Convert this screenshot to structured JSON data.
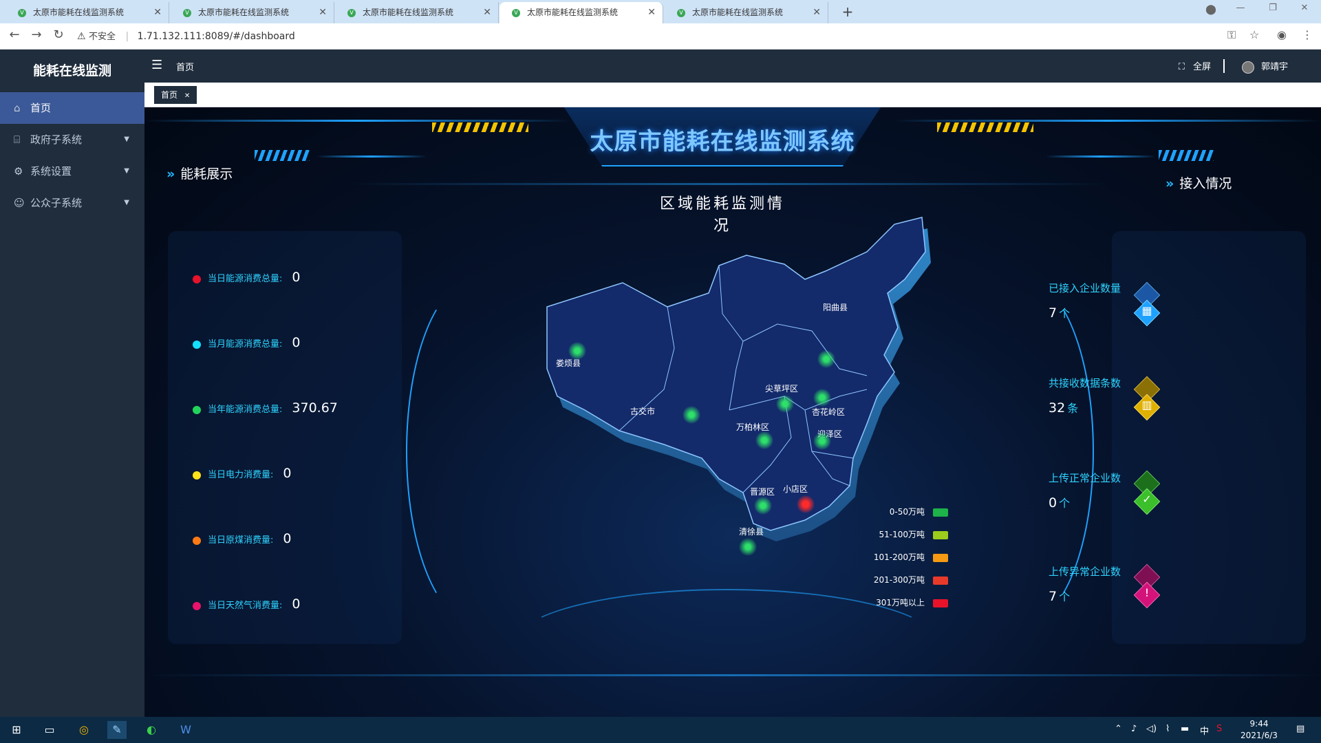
{
  "browser": {
    "tabs": [
      {
        "title": "太原市能耗在线监测系统"
      },
      {
        "title": "太原市能耗在线监测系统"
      },
      {
        "title": "太原市能耗在线监测系统"
      },
      {
        "title": "太原市能耗在线监测系统"
      },
      {
        "title": "太原市能耗在线监测系统"
      }
    ],
    "active_tab": 3,
    "security_label": "不安全",
    "url": "1.71.132.111:8089/#/dashboard"
  },
  "sidebar": {
    "logo": "能耗在线监测",
    "items": [
      {
        "label": "首页",
        "icon": "home-icon",
        "active": true
      },
      {
        "label": "政府子系统",
        "icon": "bank-icon",
        "active": false
      },
      {
        "label": "系统设置",
        "icon": "gear-icon",
        "active": false
      },
      {
        "label": "公众子系统",
        "icon": "users-icon",
        "active": false
      }
    ]
  },
  "topnav": {
    "breadcrumb": "首页",
    "fullscreen_label": "全屏",
    "user_name": "郭靖宇"
  },
  "tags": {
    "home_label": "首页"
  },
  "dashboard": {
    "title": "太原市能耗在线监测系统",
    "map_title": "区域能耗监测情况",
    "left_title": "能耗展示",
    "right_title": "接入情况",
    "stats": [
      {
        "label": "当日能源消费总量:",
        "value": "0",
        "color": "#e8132a"
      },
      {
        "label": "当月能源消费总量:",
        "value": "0",
        "color": "#14e0ff"
      },
      {
        "label": "当年能源消费总量:",
        "value": "370.67",
        "color": "#22d35a"
      },
      {
        "label": "当日电力消费量:",
        "value": "0",
        "color": "#ffe21a"
      },
      {
        "label": "当日原煤消费量:",
        "value": "0",
        "color": "#ff7a14"
      },
      {
        "label": "当日天然气消费量:",
        "value": "0",
        "color": "#e8136a"
      }
    ],
    "access": [
      {
        "label": "已接入企业数量",
        "value": "7",
        "unit": "个",
        "color": "#1fa2ff"
      },
      {
        "label": "共接收数据条数",
        "value": "32",
        "unit": "条",
        "color": "#e0b000"
      },
      {
        "label": "上传正常企业数",
        "value": "0",
        "unit": "个",
        "color": "#3bbf2a"
      },
      {
        "label": "上传异常企业数",
        "value": "7",
        "unit": "个",
        "color": "#d4137a"
      }
    ],
    "districts": [
      {
        "name": "娄烦县"
      },
      {
        "name": "阳曲县"
      },
      {
        "name": "古交市"
      },
      {
        "name": "尖草坪区"
      },
      {
        "name": "杏花岭区"
      },
      {
        "name": "万柏林区"
      },
      {
        "name": "迎泽区"
      },
      {
        "name": "晋源区"
      },
      {
        "name": "小店区"
      },
      {
        "name": "清徐县"
      }
    ],
    "legend": [
      {
        "label": "0-50万吨",
        "color": "#1db24a"
      },
      {
        "label": "51-100万吨",
        "color": "#9ccc1c"
      },
      {
        "label": "101-200万吨",
        "color": "#f59a12"
      },
      {
        "label": "201-300万吨",
        "color": "#e83a2a"
      },
      {
        "label": "301万吨以上",
        "color": "#e8132a"
      }
    ]
  },
  "taskbar": {
    "time": "9:44",
    "date": "2021/6/3",
    "ime": "中"
  }
}
